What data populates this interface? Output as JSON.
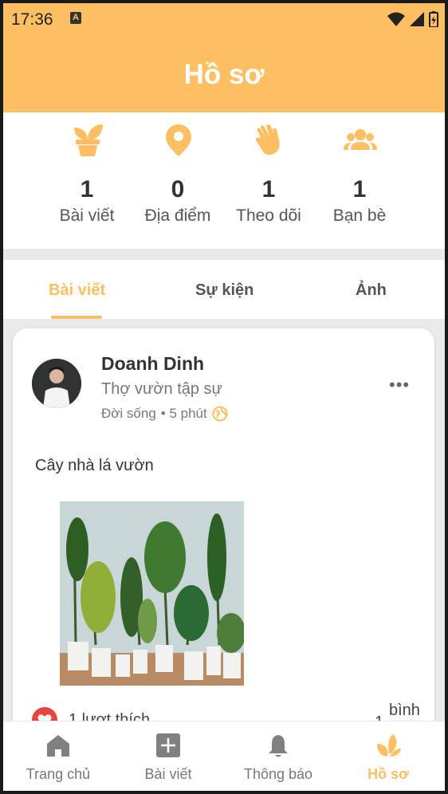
{
  "status_bar": {
    "time": "17:36",
    "notification_icon": "A"
  },
  "header": {
    "title": "Hồ sơ"
  },
  "stats": [
    {
      "icon": "plant-pot-icon",
      "value": "1",
      "label": "Bài viết"
    },
    {
      "icon": "location-pin-icon",
      "value": "0",
      "label": "Địa điểm"
    },
    {
      "icon": "waving-hand-icon",
      "value": "1",
      "label": "Theo dõi"
    },
    {
      "icon": "group-icon",
      "value": "1",
      "label": "Bạn bè"
    }
  ],
  "tabs": [
    {
      "label": "Bài viết",
      "active": true
    },
    {
      "label": "Sự kiện",
      "active": false
    },
    {
      "label": "Ảnh",
      "active": false
    }
  ],
  "post": {
    "author": "Doanh Dinh",
    "role": "Thợ vườn tập sự",
    "category": "Đời sống",
    "time": "• 5 phút",
    "content": "Cây nhà lá vườn",
    "likes": "1 lượt thích",
    "comments_count": "1",
    "comments_label": "bình"
  },
  "bottom_nav": [
    {
      "icon": "home-icon",
      "label": "Trang chủ",
      "active": false
    },
    {
      "icon": "add-post-icon",
      "label": "Bài viết",
      "active": false
    },
    {
      "icon": "bell-icon",
      "label": "Thông báo",
      "active": false
    },
    {
      "icon": "leaf-icon",
      "label": "Hồ sơ",
      "active": true
    }
  ],
  "colors": {
    "accent": "#fdbf62",
    "like": "#e8453c"
  }
}
